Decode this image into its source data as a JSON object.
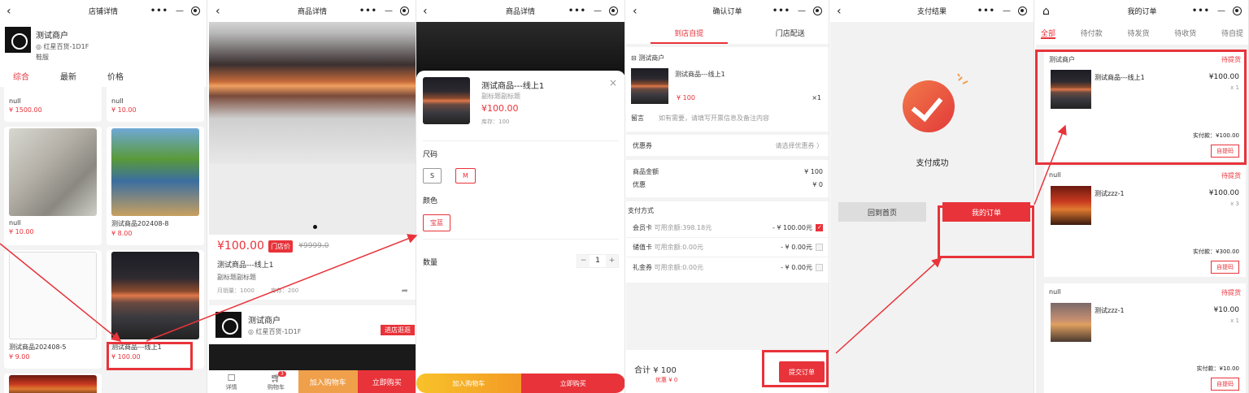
{
  "panel1": {
    "title": "店铺详情",
    "shop_name": "测试商户",
    "shop_location": "红星百货-1D1F",
    "shop_tag": "鞋服",
    "sort_tabs": [
      "综合",
      "最新",
      "价格"
    ],
    "cards": [
      {
        "title": "null",
        "price": "¥ 1500.00"
      },
      {
        "title": "null",
        "price": "¥ 10.00"
      },
      {
        "title": "null",
        "price": "¥ 10.00"
      },
      {
        "title": "测试商品202408-8",
        "price": "¥ 8.00"
      },
      {
        "title": "测试商品202408-5",
        "price": "¥ 9.00"
      },
      {
        "title": "测试商品---线上1",
        "price": "¥ 100.00"
      }
    ]
  },
  "panel2": {
    "title": "商品详情",
    "price": "¥100.00",
    "badge": "门店价",
    "old_price": "¥9999.0",
    "name": "测试商品---线上1",
    "subtitle": "副标题副标题",
    "monthly_sales": "月销量：1000",
    "stock": "库存：200",
    "shop_name": "测试商户",
    "shop_location": "红星百货-1D1F",
    "visit_store": "进店逛逛",
    "nav_detail": "详情",
    "nav_cart": "购物车",
    "cart_badge": "3",
    "add_cart": "加入购物车",
    "buy_now": "立即购买"
  },
  "panel3": {
    "title": "商品详情",
    "name": "测试商品---线上1",
    "subtitle": "副标题副标题",
    "price": "¥100.00",
    "stock": "库存：100",
    "size_label": "尺码",
    "sizes": [
      "S",
      "M"
    ],
    "color_label": "颜色",
    "colors": [
      "宝蓝"
    ],
    "qty_label": "数量",
    "qty": "1",
    "minus": "−",
    "plus": "+",
    "add_cart": "加入购物车",
    "buy_now": "立即购买",
    "close": "×"
  },
  "panel4": {
    "title": "确认订单",
    "tab_pickup": "到店自提",
    "tab_delivery": "门店配送",
    "shop_name": "测试商户",
    "item_name": "测试商品---线上1",
    "item_price": "¥ 100",
    "item_qty": "×1",
    "remark_label": "留言",
    "remark_placeholder": "如有需要，请填写开票信息及备注内容",
    "coupon_label": "优惠券",
    "coupon_value": "请选择优惠券 〉",
    "amount_label": "商品金额",
    "amount_value": "¥ 100",
    "discount_label": "优惠",
    "discount_value": "¥ 0",
    "pay_label": "支付方式",
    "pay_methods": [
      {
        "name": "会员卡",
        "balance": "可用余额:398.18元",
        "amount": "- ¥ 100.00元"
      },
      {
        "name": "储值卡",
        "balance": "可用余额:0.00元",
        "amount": "- ¥ 0.00元"
      },
      {
        "name": "礼金券",
        "balance": "可用余额:0.00元",
        "amount": "- ¥ 0.00元"
      }
    ],
    "total_label": "合计",
    "total_value": "¥ 100",
    "total_discount": "优惠 ¥ 0",
    "submit": "提交订单"
  },
  "panel5": {
    "title": "支付结果",
    "success": "支付成功",
    "home": "回到首页",
    "my_orders": "我的订单"
  },
  "panel6": {
    "title": "我的订单",
    "tabs": [
      "全部",
      "待付款",
      "待发货",
      "待收货",
      "待自提"
    ],
    "orders": [
      {
        "shop": "测试商户",
        "status": "待提货",
        "item": "测试商品---线上1",
        "price": "¥100.00",
        "qty": "x 1",
        "total": "实付款：¥100.00",
        "action": "自提码"
      },
      {
        "shop": "null",
        "status": "待提货",
        "item": "测试zzz-1",
        "price": "¥100.00",
        "qty": "x 3",
        "total": "实付款：¥300.00",
        "action": "自提码"
      },
      {
        "shop": "null",
        "status": "待提货",
        "item": "测试zzz-1",
        "price": "¥10.00",
        "qty": "x 1",
        "total": "实付款：¥10.00",
        "action": "自提码"
      }
    ]
  },
  "colors": {
    "accent": "#e8333a",
    "orange": "#f0a04a"
  },
  "icons": {
    "back": "chevron-left-icon",
    "more": "more-dots-icon",
    "minimize": "minimize-icon",
    "target": "target-icon",
    "home": "home-icon"
  }
}
